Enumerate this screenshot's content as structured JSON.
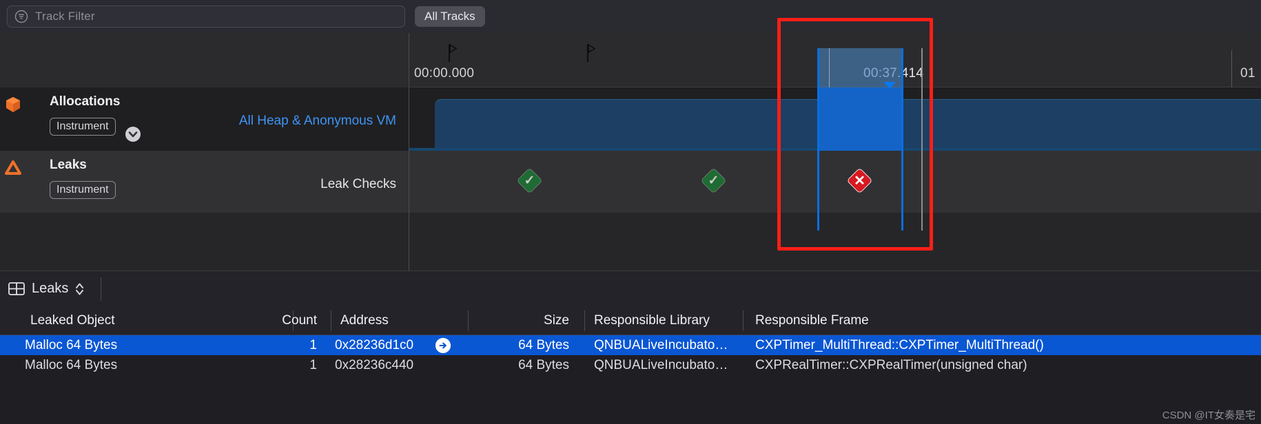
{
  "toolbar": {
    "filter_placeholder": "Track Filter",
    "filter_icon": "filter-lines-icon",
    "all_tracks_label": "All Tracks"
  },
  "timeline": {
    "start_time_label": "00:00.000",
    "selection_time_label": "00:37.414",
    "right_edge_label": "01",
    "flags": [
      "flag-marker",
      "flag-marker"
    ],
    "tracks": [
      {
        "name": "Allocations",
        "icon": "orange-cube-icon",
        "instrument_label": "Instrument",
        "instrument_chevron": "chevron-down-icon",
        "subtitle": "All Heap & Anonymous VM",
        "subtitle_color": "#3f94f5"
      },
      {
        "name": "Leaks",
        "icon": "orange-triangle-icon",
        "instrument_label": "Instrument",
        "instrument_chevron": "chevron-down-icon",
        "subtitle": "Leak Checks",
        "subtitle_color": "#e6e6ea"
      }
    ],
    "leak_checks": [
      {
        "status": "pass",
        "glyph": "✓"
      },
      {
        "status": "pass",
        "glyph": "✓"
      },
      {
        "status": "fail",
        "glyph": "✕"
      }
    ],
    "highlight_color": "#fd1f17",
    "selection_color": "#0a6ee0"
  },
  "detail": {
    "tab_icon": "table-grid-icon",
    "tab_label": "Leaks",
    "tab_stepper_icon": "stepper-updown-icon",
    "columns": [
      {
        "label": "Leaked Object",
        "align": "left"
      },
      {
        "label": "Count",
        "align": "right"
      },
      {
        "label": "Address",
        "align": "left"
      },
      {
        "label": "Size",
        "align": "right"
      },
      {
        "label": "Responsible Library",
        "align": "left"
      },
      {
        "label": "Responsible Frame",
        "align": "left"
      }
    ],
    "rows": [
      {
        "selected": true,
        "leaked_object": "Malloc 64 Bytes",
        "count": "1",
        "address": "0x28236d1c0",
        "address_badge": "arrow-right-icon",
        "size": "64 Bytes",
        "responsible_library": "QNBUALiveIncubato…",
        "responsible_frame": "CXPTimer_MultiThread::CXPTimer_MultiThread()"
      },
      {
        "selected": false,
        "leaked_object": "Malloc 64 Bytes",
        "count": "1",
        "address": "0x28236c440",
        "address_badge": null,
        "size": "64 Bytes",
        "responsible_library": "QNBUALiveIncubato…",
        "responsible_frame": "CXPRealTimer::CXPRealTimer(unsigned char)"
      }
    ]
  },
  "watermark": {
    "text": "CSDN @IT女奏是宅"
  }
}
